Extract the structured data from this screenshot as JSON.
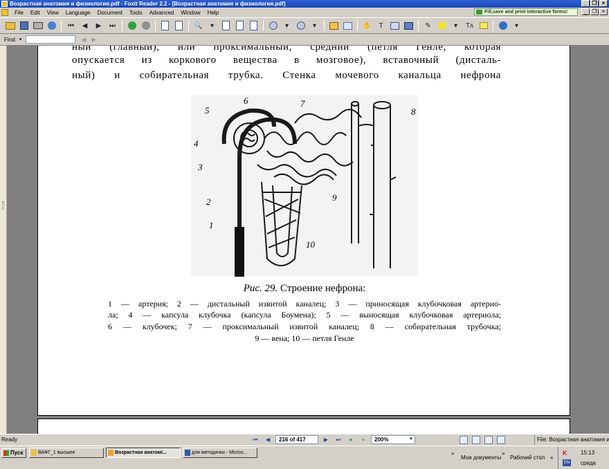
{
  "window": {
    "title": "Возрастная анатомия и физиология.pdf - Foxit Reader 2.2 - [Возрастная анатомия и физиология.pdf]",
    "controls": [
      "_",
      "❐",
      "×"
    ]
  },
  "menu": {
    "items": [
      "File",
      "Edit",
      "View",
      "Language",
      "Document",
      "Tools",
      "Advanced",
      "Window",
      "Help"
    ],
    "promo": "Fill,save and print interactive forms!"
  },
  "find": {
    "label": "Find:",
    "value": ""
  },
  "page": {
    "lines": [
      "ный (главный), или проксимальный, средний (петля Генле, которая",
      "опускается из коркового вещества в мозговое), вставочный (дисталь-",
      "ный) и собирательная трубка. Стенка мочевого канальца нефрона"
    ],
    "figure_labels": [
      "1",
      "2",
      "3",
      "4",
      "5",
      "6",
      "7",
      "8",
      "9",
      "10"
    ],
    "caption_label": "Рис. 29.",
    "caption_title": "Строение нефрона:",
    "caption_lines": [
      "1 — артерия; 2 — дистальный извитой каналец; 3 — приносящая клубочковая артерио-",
      "ла; 4 — капсула клубочка (капсула Боумена); 5 — выносящая клубочковая артериола;",
      "6 — клубочек; 7 — проксимальный извитой каналец; 8 — собирательная трубочка;",
      "9 — вена; 10 — петля Генле"
    ]
  },
  "status": {
    "ready": "Ready",
    "page_display": "216 of 417",
    "zoom": "200%",
    "file_label": "File: Возрастная анатомия и физиол"
  },
  "taskbar": {
    "start": "Пуск",
    "tasks": [
      "ВАФГ_1 высшее",
      "Возрастная анатомі...",
      "для методички - Micros..."
    ],
    "links": [
      "Мои документы",
      "Рабочий стол"
    ],
    "time": "15:13",
    "day": "среда",
    "lang": "EN"
  }
}
